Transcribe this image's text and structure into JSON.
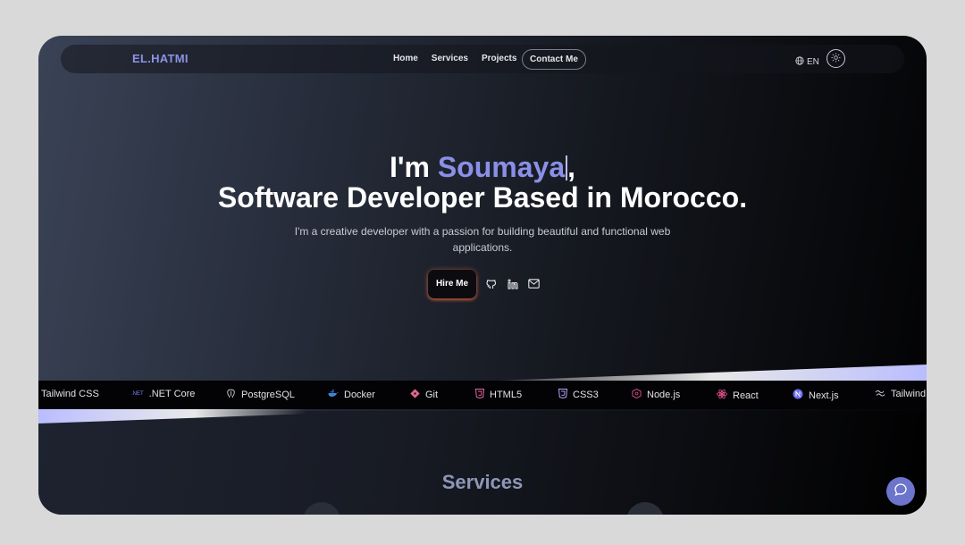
{
  "nav": {
    "logo": "EL.HATMI",
    "links": [
      "Home",
      "Services",
      "Projects"
    ],
    "contact": "Contact Me",
    "lang": "EN"
  },
  "hero": {
    "greeting": "I'm ",
    "name": "Soumaya",
    "comma": ",",
    "line2": "Software Developer Based in Morocco.",
    "subtitle": "I'm a creative developer with a passion for building beautiful and functional web applications.",
    "hire": "Hire Me"
  },
  "tech": [
    {
      "label": "Tailwind CSS",
      "icon": "tailwind-icon"
    },
    {
      "label": ".NET Core",
      "icon": "dotnet-icon",
      "badge": ".NET"
    },
    {
      "label": "PostgreSQL",
      "icon": "postgresql-icon"
    },
    {
      "label": "Docker",
      "icon": "docker-icon"
    },
    {
      "label": "Git",
      "icon": "git-icon"
    },
    {
      "label": "HTML5",
      "icon": "html5-icon"
    },
    {
      "label": "CSS3",
      "icon": "css3-icon"
    },
    {
      "label": "Node.js",
      "icon": "nodejs-icon"
    },
    {
      "label": "React",
      "icon": "react-icon"
    },
    {
      "label": "Next.js",
      "icon": "nextjs-icon"
    },
    {
      "label": "Tailwind",
      "icon": "tailwind-icon"
    }
  ],
  "services": {
    "title": "Services"
  },
  "colors": {
    "accent": "#8a8fe8",
    "chat": "#6d74cc"
  }
}
